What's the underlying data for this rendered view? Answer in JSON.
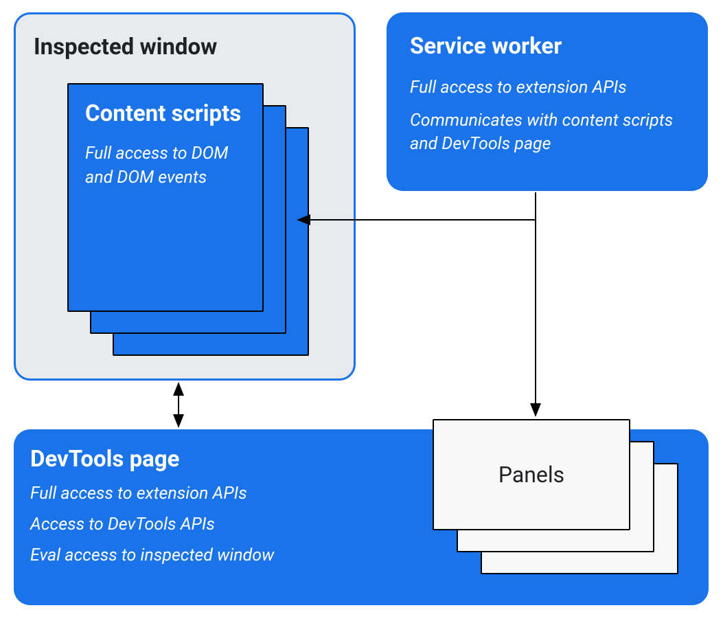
{
  "inspected_window": {
    "title": "Inspected window",
    "content_scripts": {
      "title": "Content scripts",
      "desc": "Full access to DOM and DOM events"
    }
  },
  "service_worker": {
    "title": "Service worker",
    "desc1": "Full access to extension APIs",
    "desc2": "Communicates with content scripts and DevTools page"
  },
  "devtools_page": {
    "title": "DevTools page",
    "desc1": "Full access to extension APIs",
    "desc2": "Access to DevTools APIs",
    "desc3": "Eval access to inspected window",
    "panels": {
      "title": "Panels"
    }
  },
  "colors": {
    "blue": "#1a73e8",
    "grey": "#e8eaed"
  }
}
